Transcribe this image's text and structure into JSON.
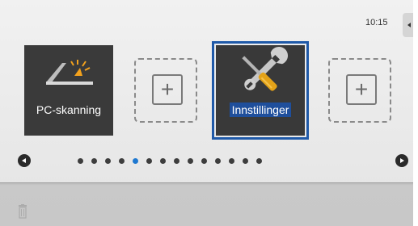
{
  "status_bar": {
    "time": "10:15"
  },
  "apps": [
    {
      "label": "PC-skanning",
      "icon": "scanner-icon",
      "selected": false
    },
    {
      "label": "",
      "icon": "plus-icon",
      "empty": true
    },
    {
      "label": "Innstillinger",
      "icon": "wrench-screwdriver-icon",
      "selected": true
    },
    {
      "label": "",
      "icon": "plus-icon",
      "empty": true
    }
  ],
  "page_indicator": {
    "pages": 14,
    "current": 5
  },
  "colors": {
    "selection_outline": "#1f59a8",
    "active_dot": "#1e78d0",
    "tile_bg": "#3a3a3a",
    "scanner_light": "#f3a21d"
  },
  "bottom_bar": {
    "icon": "trash-icon"
  }
}
